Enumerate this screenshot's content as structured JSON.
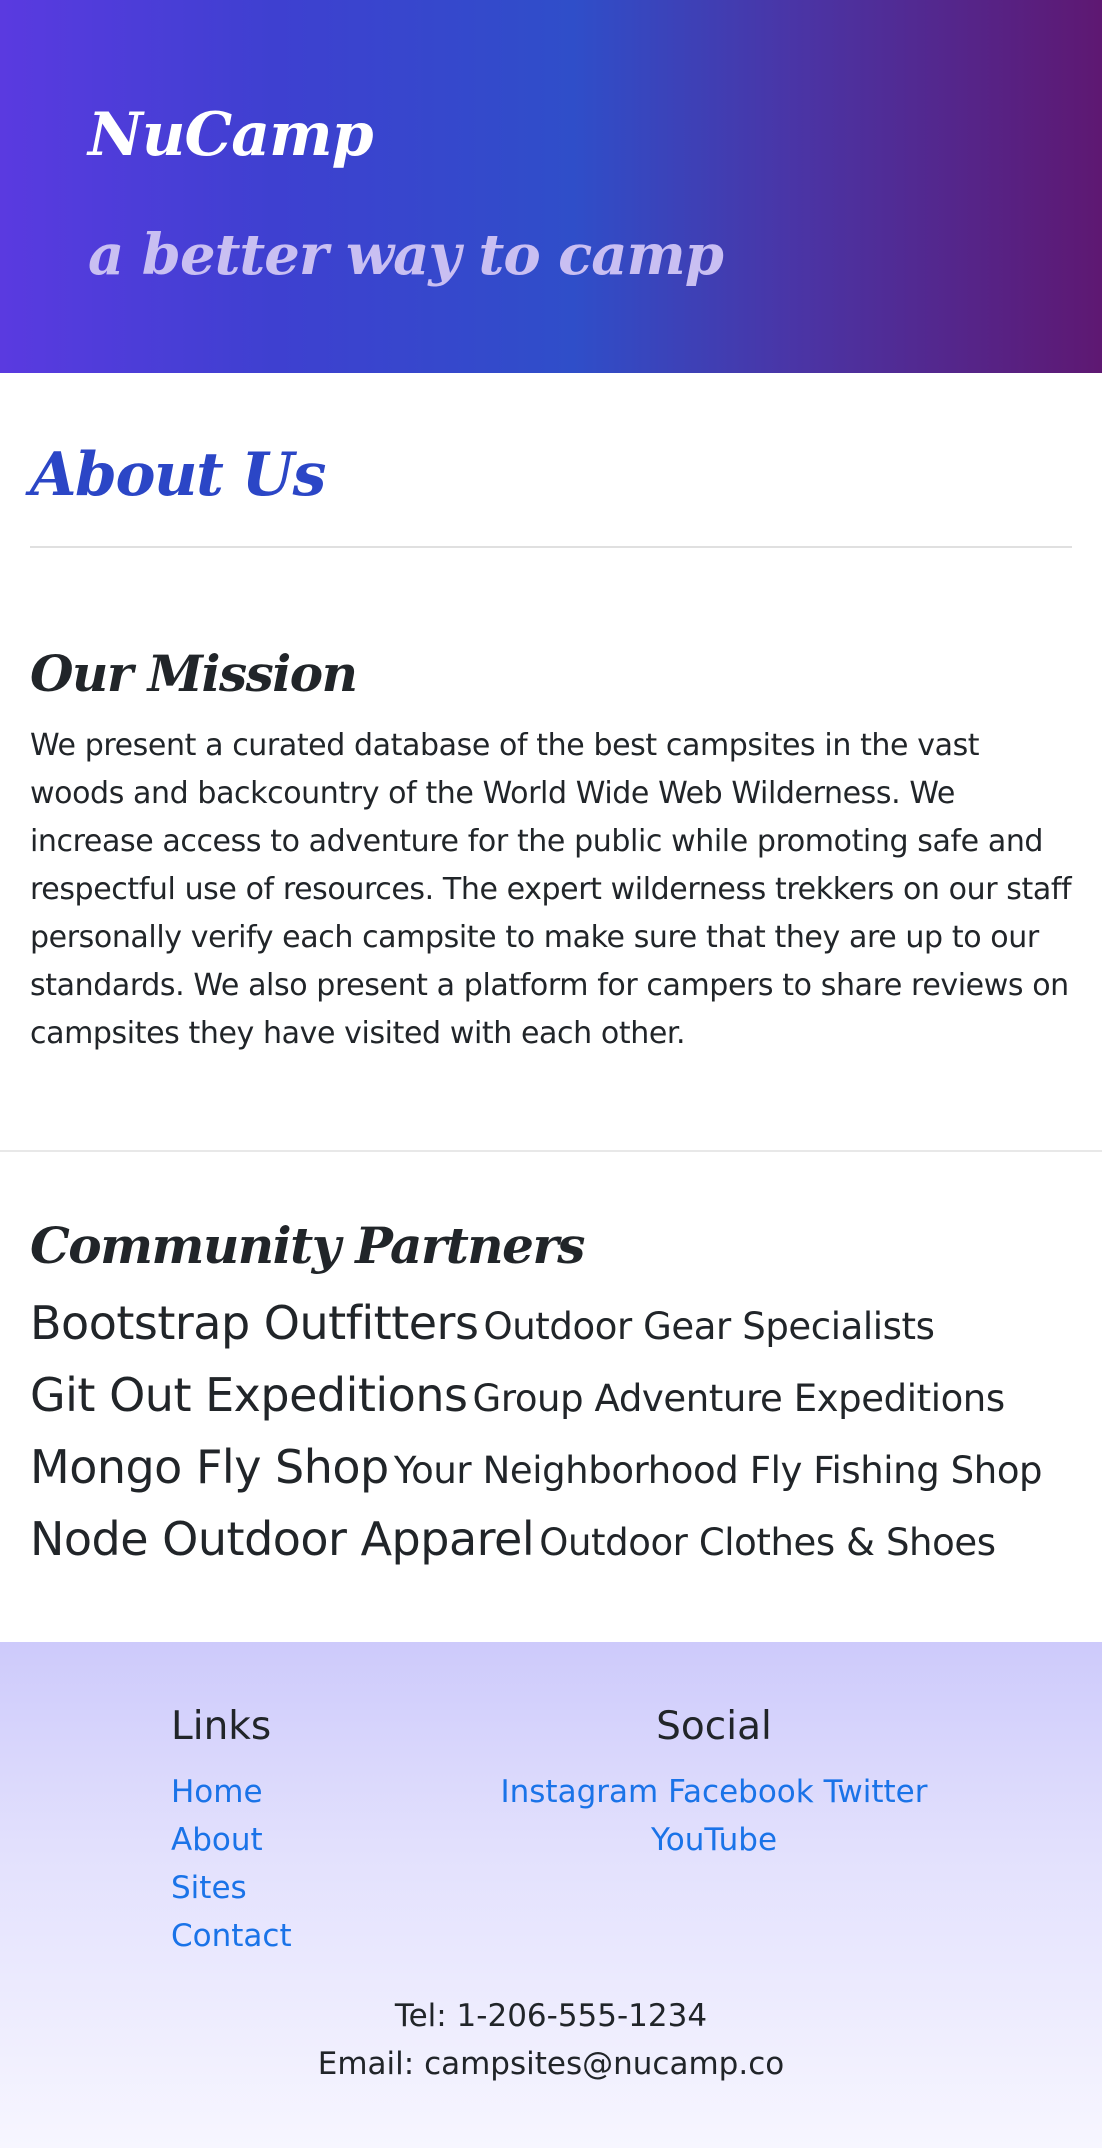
{
  "header": {
    "brand": "NuCamp",
    "tagline": "a better way to camp"
  },
  "main": {
    "title": "About Us",
    "mission": {
      "heading": "Our Mission",
      "text": "We present a curated database of the best campsites in the vast woods and backcountry of the World Wide Web Wilderness. We increase access to adventure for the public while promoting safe and respectful use of resources. The expert wilderness trekkers on our staff personally verify each campsite to make sure that they are up to our standards. We also present a platform for campers to share reviews on campsites they have visited with each other."
    },
    "partners": {
      "heading": "Community Partners",
      "items": [
        {
          "name": "Bootstrap Outfitters",
          "desc": "Outdoor Gear Specialists"
        },
        {
          "name": "Git Out Expeditions",
          "desc": "Group Adventure Expeditions"
        },
        {
          "name": "Mongo Fly Shop",
          "desc": "Your Neighborhood Fly Fishing Shop"
        },
        {
          "name": "Node Outdoor Apparel",
          "desc": "Outdoor Clothes & Shoes"
        }
      ]
    }
  },
  "footer": {
    "links_title": "Links",
    "links": [
      "Home",
      "About",
      "Sites",
      "Contact"
    ],
    "social_title": "Social",
    "social": [
      "Instagram",
      "Facebook",
      "Twitter",
      "YouTube"
    ],
    "tel": "Tel: 1-206-555-1234",
    "email": "Email: campsites@nucamp.co"
  },
  "colors": {
    "brand_blue": "#2b46c6",
    "link": "#1a73e8",
    "footer_top": "#cdcafb"
  }
}
